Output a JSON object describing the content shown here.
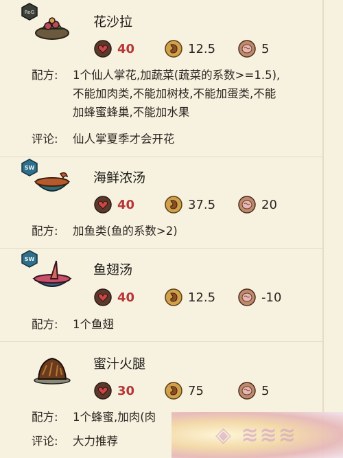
{
  "labels": {
    "recipe": "配方:",
    "comment": "评论:"
  },
  "entries": [
    {
      "badge": "RoG",
      "icon": "cactus-flower-salad-icon",
      "name": "花沙拉",
      "health": "40",
      "hunger": "12.5",
      "sanity": "5",
      "recipe_lines": [
        "1个仙人掌花,加蔬菜(蔬菜的系数>=1.5),",
        "不能加肉类,不能加树枝,不能加蛋类,不能",
        "加蜂蜜蜂巢,不能加水果"
      ],
      "comment": "仙人掌夏季才会开花"
    },
    {
      "badge": "SW",
      "icon": "seafood-gumbo-icon",
      "name": "海鲜浓汤",
      "health": "40",
      "hunger": "37.5",
      "sanity": "20",
      "recipe_lines": [
        "加鱼类(鱼的系数>2)"
      ]
    },
    {
      "badge": "SW",
      "icon": "shark-fin-soup-icon",
      "name": "鱼翅汤",
      "health": "40",
      "hunger": "12.5",
      "sanity": "-10",
      "recipe_lines": [
        "1个鱼翅"
      ]
    },
    {
      "badge": "",
      "icon": "honey-ham-icon",
      "name": "蜜汁火腿",
      "health": "30",
      "hunger": "75",
      "sanity": "5",
      "recipe_lines": [
        "1个蜂蜜,加肉(肉"
      ],
      "comment": "大力推荐"
    }
  ],
  "colors": {
    "background": "#f7f2e0",
    "health": "#b73737",
    "text": "#2b2520"
  }
}
